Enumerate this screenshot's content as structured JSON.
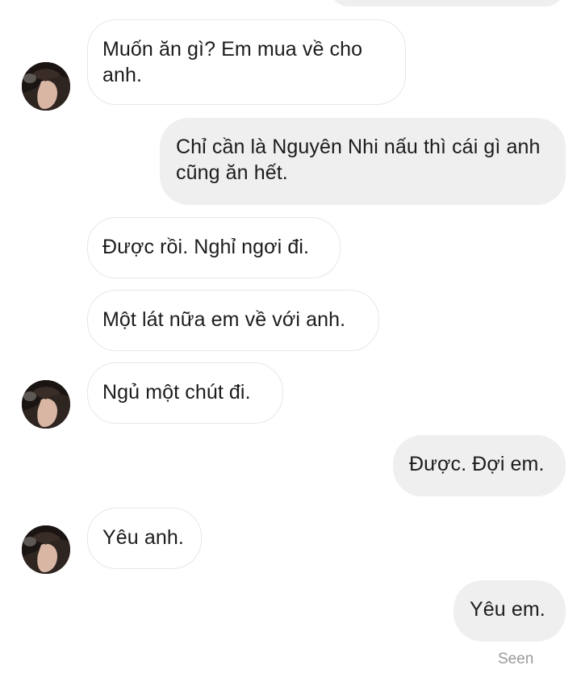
{
  "messages": [
    {
      "from": "them",
      "text": "Muốn ăn gì? Em mua về cho anh."
    },
    {
      "from": "me",
      "text": "Chỉ cần là Nguyên Nhi nấu thì cái gì anh cũng ăn hết."
    },
    {
      "from": "them",
      "text": "Được rồi. Nghỉ ngơi đi."
    },
    {
      "from": "them",
      "text": "Một lát nữa em về với anh."
    },
    {
      "from": "them",
      "text": "Ngủ một chút đi."
    },
    {
      "from": "me",
      "text": "Được. Đợi em."
    },
    {
      "from": "them",
      "text": "Yêu anh."
    },
    {
      "from": "me",
      "text": "Yêu em."
    }
  ],
  "status": {
    "seen_label": "Seen"
  },
  "icons": {
    "avatar": "contact-avatar-icon"
  },
  "colors": {
    "outgoing_bubble": "#efefef",
    "incoming_bubble": "#ffffff",
    "incoming_border": "#e7e7e7",
    "text": "#1c1c1c",
    "seen": "#9a9a9a"
  }
}
